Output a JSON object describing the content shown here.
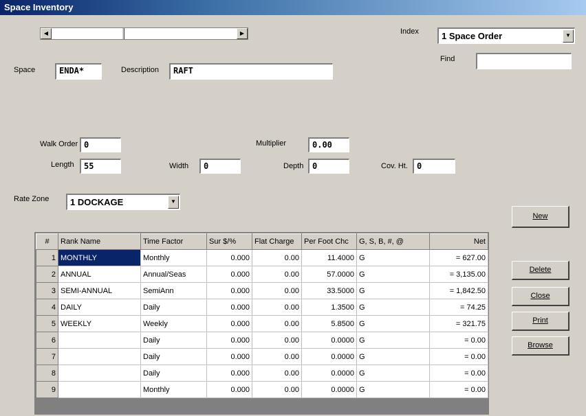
{
  "window": {
    "title": "Space Inventory"
  },
  "index": {
    "label": "Index",
    "value": "1 Space Order"
  },
  "find": {
    "label": "Find",
    "value": ""
  },
  "space": {
    "label": "Space",
    "value": "ENDA*"
  },
  "description": {
    "label": "Description",
    "value": "RAFT"
  },
  "walk_order": {
    "label": "Walk Order",
    "value": "0"
  },
  "multiplier": {
    "label": "Multiplier",
    "value": "0.00"
  },
  "length": {
    "label": "Length",
    "value": "55"
  },
  "width": {
    "label": "Width",
    "value": "0"
  },
  "depth": {
    "label": "Depth",
    "value": "0"
  },
  "cov_ht": {
    "label": "Cov. Ht.",
    "value": "0"
  },
  "rate_zone": {
    "label": "Rate Zone",
    "value": "1 DOCKAGE"
  },
  "buttons": {
    "new": "New",
    "delete": "Delete",
    "close": "Close",
    "print": "Print",
    "browse": "Browse"
  },
  "grid": {
    "headers": [
      "#",
      "Rank Name",
      "Time Factor",
      "Sur $/%",
      "Flat Charge",
      "Per Foot Chc",
      "G, S, B, #, @",
      "Net"
    ],
    "rows": [
      [
        "1",
        "MONTHLY",
        "Monthly",
        "0.000",
        "0.00",
        "11.4000",
        "G",
        "= 627.00"
      ],
      [
        "2",
        "ANNUAL",
        "Annual/Seas",
        "0.000",
        "0.00",
        "57.0000",
        "G",
        "= 3,135.00"
      ],
      [
        "3",
        "SEMI-ANNUAL",
        "SemiAnn",
        "0.000",
        "0.00",
        "33.5000",
        "G",
        "= 1,842.50"
      ],
      [
        "4",
        "DAILY",
        "Daily",
        "0.000",
        "0.00",
        "1.3500",
        "G",
        "= 74.25"
      ],
      [
        "5",
        "WEEKLY",
        "Weekly",
        "0.000",
        "0.00",
        "5.8500",
        "G",
        "= 321.75"
      ],
      [
        "6",
        "",
        "Daily",
        "0.000",
        "0.00",
        "0.0000",
        "G",
        "= 0.00"
      ],
      [
        "7",
        "",
        "Daily",
        "0.000",
        "0.00",
        "0.0000",
        "G",
        "= 0.00"
      ],
      [
        "8",
        "",
        "Daily",
        "0.000",
        "0.00",
        "0.0000",
        "G",
        "= 0.00"
      ],
      [
        "9",
        "",
        "Monthly",
        "0.000",
        "0.00",
        "0.0000",
        "G",
        "= 0.00"
      ]
    ]
  }
}
